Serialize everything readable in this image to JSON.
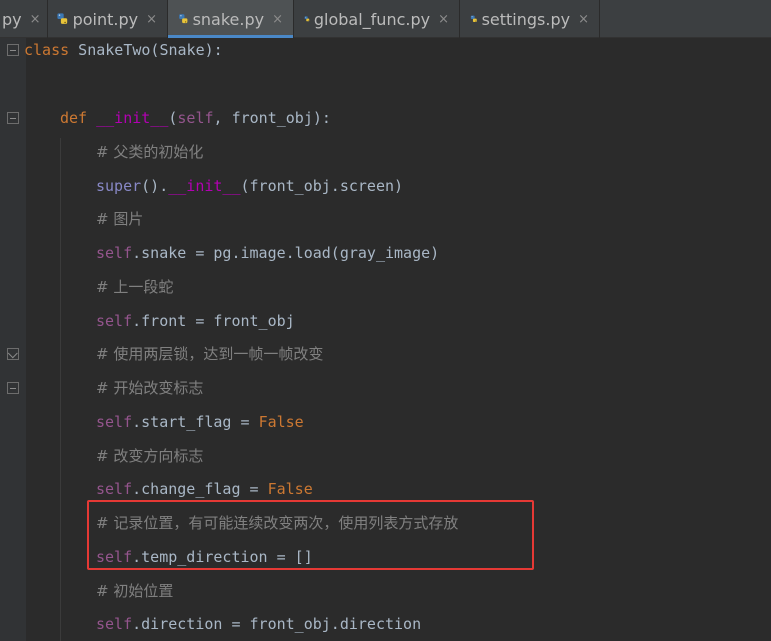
{
  "tabs": [
    {
      "label": "py",
      "active": false,
      "icon": "python-file-icon"
    },
    {
      "label": "point.py",
      "active": false,
      "icon": "python-file-icon"
    },
    {
      "label": "snake.py",
      "active": true,
      "icon": "python-file-icon"
    },
    {
      "label": "global_func.py",
      "active": false,
      "icon": "python-file-icon"
    },
    {
      "label": "settings.py",
      "active": false,
      "icon": "python-file-icon"
    }
  ],
  "close_glyph": "×",
  "code": {
    "l0": {
      "kw": "class",
      "rest": " SnakeTwo(Snake):"
    },
    "l2": {
      "kw": "def",
      "sp": " ",
      "dunder": "__init__",
      "p1": "(",
      "self": "self",
      "p2": ", front_obj):"
    },
    "l3": "# 父类的初始化",
    "l4": {
      "builtin": "super",
      "p1": "().",
      "dunder": "__init__",
      "p2": "(front_obj.screen)"
    },
    "l5": "# 图片",
    "l6": {
      "self": "self",
      "rest": ".snake = pg.image.load(gray_image)"
    },
    "l7": "# 上一段蛇",
    "l8": {
      "self": "self",
      "rest": ".front = front_obj"
    },
    "l9": "# 使用两层锁，达到一帧一帧改变",
    "l10": "# 开始改变标志",
    "l11": {
      "self": "self",
      "rest": ".start_flag = ",
      "kw": "False"
    },
    "l12": "# 改变方向标志",
    "l13": {
      "self": "self",
      "rest": ".change_flag = ",
      "kw": "False"
    },
    "l14": "# 记录位置，有可能连续改变两次，使用列表方式存放",
    "l15": {
      "self": "self",
      "rest": ".temp_direction = []"
    },
    "l16": "# 初始位置",
    "l17": {
      "self": "self",
      "rest": ".direction = front_obj.direction"
    }
  },
  "colors": {
    "keyword": "#cc7832",
    "self": "#94558d",
    "dunder": "#b200b2",
    "comment": "#808080",
    "highlight_box": "#e53935",
    "active_tab_underline": "#4a88c7"
  }
}
